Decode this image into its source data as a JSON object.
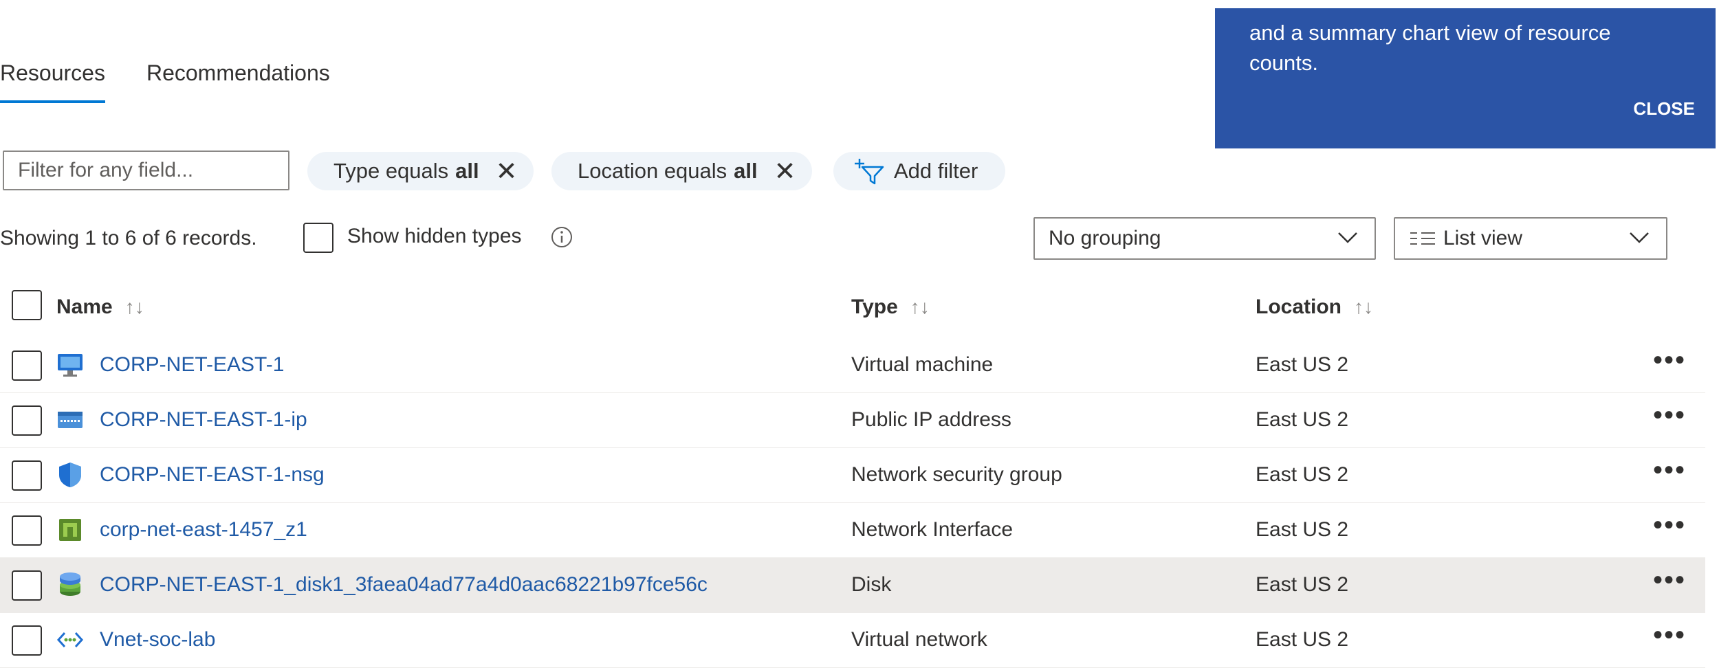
{
  "tabs": [
    {
      "label": "Resources"
    },
    {
      "label": "Recommendations"
    }
  ],
  "teaching_bubble": {
    "text": "and a summary chart view of resource counts.",
    "close_label": "CLOSE"
  },
  "filters": {
    "placeholder": "Filter for any field...",
    "type_pill": {
      "prefix": "Type equals",
      "value": "all"
    },
    "location_pill": {
      "prefix": "Location equals",
      "value": "all"
    },
    "add_filter_label": "Add filter"
  },
  "status": {
    "records_text": "Showing 1 to 6 of 6 records.",
    "show_hidden_label": "Show hidden types"
  },
  "grouping_dropdown": {
    "selected": "No grouping"
  },
  "view_dropdown": {
    "selected": "List view"
  },
  "table": {
    "columns": [
      "Name",
      "Type",
      "Location"
    ],
    "rows": [
      {
        "name": "CORP-NET-EAST-1",
        "type": "Virtual machine",
        "location": "East US 2",
        "icon": "virtual-machine-icon"
      },
      {
        "name": "CORP-NET-EAST-1-ip",
        "type": "Public IP address",
        "location": "East US 2",
        "icon": "public-ip-icon"
      },
      {
        "name": "CORP-NET-EAST-1-nsg",
        "type": "Network security group",
        "location": "East US 2",
        "icon": "shield-icon"
      },
      {
        "name": "corp-net-east-1457_z1",
        "type": "Network Interface",
        "location": "East US 2",
        "icon": "network-interface-icon"
      },
      {
        "name": "CORP-NET-EAST-1_disk1_3faea04ad77a4d0aac68221b97fce56c",
        "type": "Disk",
        "location": "East US 2",
        "icon": "disk-icon"
      },
      {
        "name": "Vnet-soc-lab",
        "type": "Virtual network",
        "location": "East US 2",
        "icon": "virtual-network-icon"
      }
    ],
    "more_label": "•••"
  },
  "colors": {
    "accent": "#0078d4",
    "bubble": "#2b54a6",
    "link": "#1f5aa6",
    "selected_row": "#edebe9"
  }
}
